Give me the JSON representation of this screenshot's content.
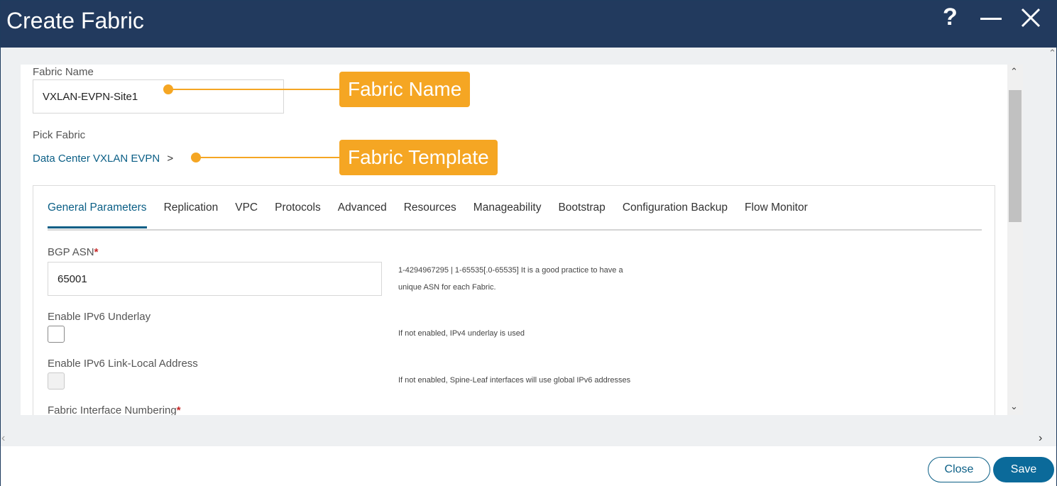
{
  "window": {
    "title": "Create Fabric",
    "help_label": "?"
  },
  "fabric_name": {
    "label": "Fabric Name",
    "value": "VXLAN-EVPN-Site1"
  },
  "pick_fabric": {
    "label": "Pick Fabric",
    "link_text": "Data Center VXLAN EVPN",
    "chevron": ">"
  },
  "callouts": {
    "fabric_name": "Fabric Name",
    "fabric_template": "Fabric Template",
    "color": "#f5a623"
  },
  "tabs": [
    {
      "label": "General Parameters",
      "active": true
    },
    {
      "label": "Replication"
    },
    {
      "label": "VPC"
    },
    {
      "label": "Protocols"
    },
    {
      "label": "Advanced"
    },
    {
      "label": "Resources"
    },
    {
      "label": "Manageability"
    },
    {
      "label": "Bootstrap"
    },
    {
      "label": "Configuration Backup"
    },
    {
      "label": "Flow Monitor"
    }
  ],
  "general": {
    "bgp_asn": {
      "label": "BGP ASN",
      "required_mark": "*",
      "value": "65001",
      "hint_line1": "1-4294967295 | 1-65535[.0-65535] It is a good practice to have a",
      "hint_line2": "unique ASN for each Fabric."
    },
    "ipv6_underlay": {
      "label": "Enable IPv6 Underlay",
      "checked": false,
      "hint": "If not enabled, IPv4 underlay is used"
    },
    "ipv6_link_local": {
      "label": "Enable IPv6 Link-Local Address",
      "checked": false,
      "disabled": true,
      "hint": "If not enabled, Spine-Leaf interfaces will use global IPv6 addresses"
    },
    "interface_numbering": {
      "label": "Fabric Interface Numbering",
      "required_mark": "*"
    }
  },
  "footer": {
    "close_label": "Close",
    "save_label": "Save"
  },
  "colors": {
    "titlebar": "#223a5e",
    "accent": "#0b5f86",
    "save_bg": "#0b6a9a"
  }
}
